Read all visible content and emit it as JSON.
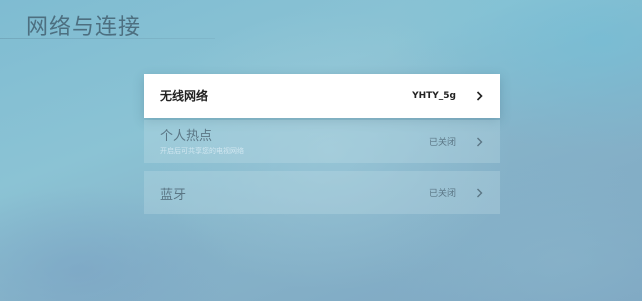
{
  "page": {
    "title": "网络与连接"
  },
  "items": [
    {
      "label": "无线网络",
      "value": "YHTY_5g",
      "subtitle": ""
    },
    {
      "label": "个人热点",
      "value": "已关闭",
      "subtitle": "开启后可共享您的电视网络"
    },
    {
      "label": "蓝牙",
      "value": "已关闭",
      "subtitle": ""
    }
  ],
  "icons": {
    "chevron": "chevron-right-icon"
  },
  "colors": {
    "background": "#86bdd2",
    "title": "#4d6f80",
    "active_bg": "#ffffff"
  }
}
